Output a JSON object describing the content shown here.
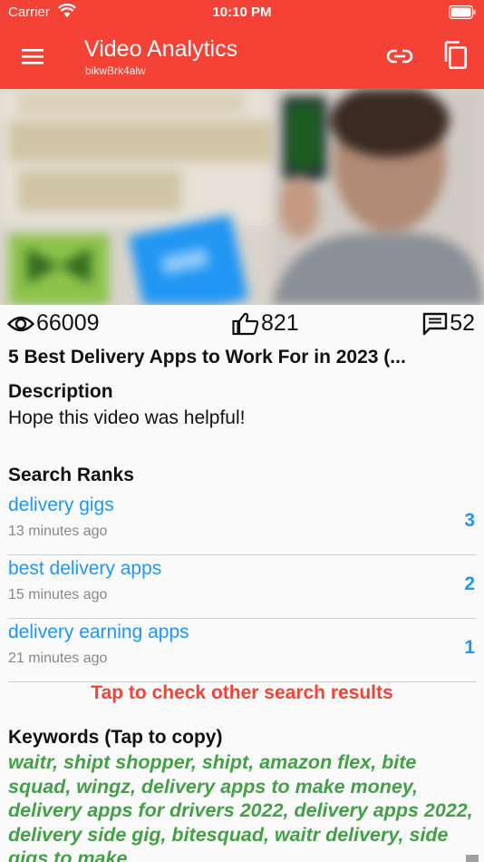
{
  "status_bar": {
    "carrier": "Carrier",
    "time": "10:10 PM"
  },
  "app_bar": {
    "title": "Video Analytics",
    "video_id": "bikwBrk4alw",
    "accent": "#f44336"
  },
  "icons": [
    "menu-icon",
    "link-icon",
    "copy-icon",
    "eye-icon",
    "thumb-up-icon",
    "comment-icon"
  ],
  "stats": {
    "views": "66009",
    "likes": "821",
    "comments": "52"
  },
  "video": {
    "title": "5 Best Delivery Apps to Work For in 2023 (..."
  },
  "description": {
    "heading": "Description",
    "text": "Hope this video was helpful!"
  },
  "search_ranks": {
    "heading": "Search Ranks",
    "items": [
      {
        "term": "delivery gigs",
        "time": "13 minutes ago",
        "rank": "3"
      },
      {
        "term": "best delivery apps",
        "time": "15 minutes ago",
        "rank": "2"
      },
      {
        "term": "delivery earning apps",
        "time": "21 minutes ago",
        "rank": "1"
      }
    ],
    "link_color": "#2196f3"
  },
  "other_results": {
    "label": "Tap to check other search results"
  },
  "keywords": {
    "heading": "Keywords (Tap to copy)",
    "text": "waitr, shipt shopper, shipt, amazon flex, bite squad, wingz, delivery apps to make money, delivery apps for drivers 2022, delivery apps 2022, delivery side gig, bitesquad, waitr delivery, side gigs to make",
    "color": "#43a047"
  }
}
